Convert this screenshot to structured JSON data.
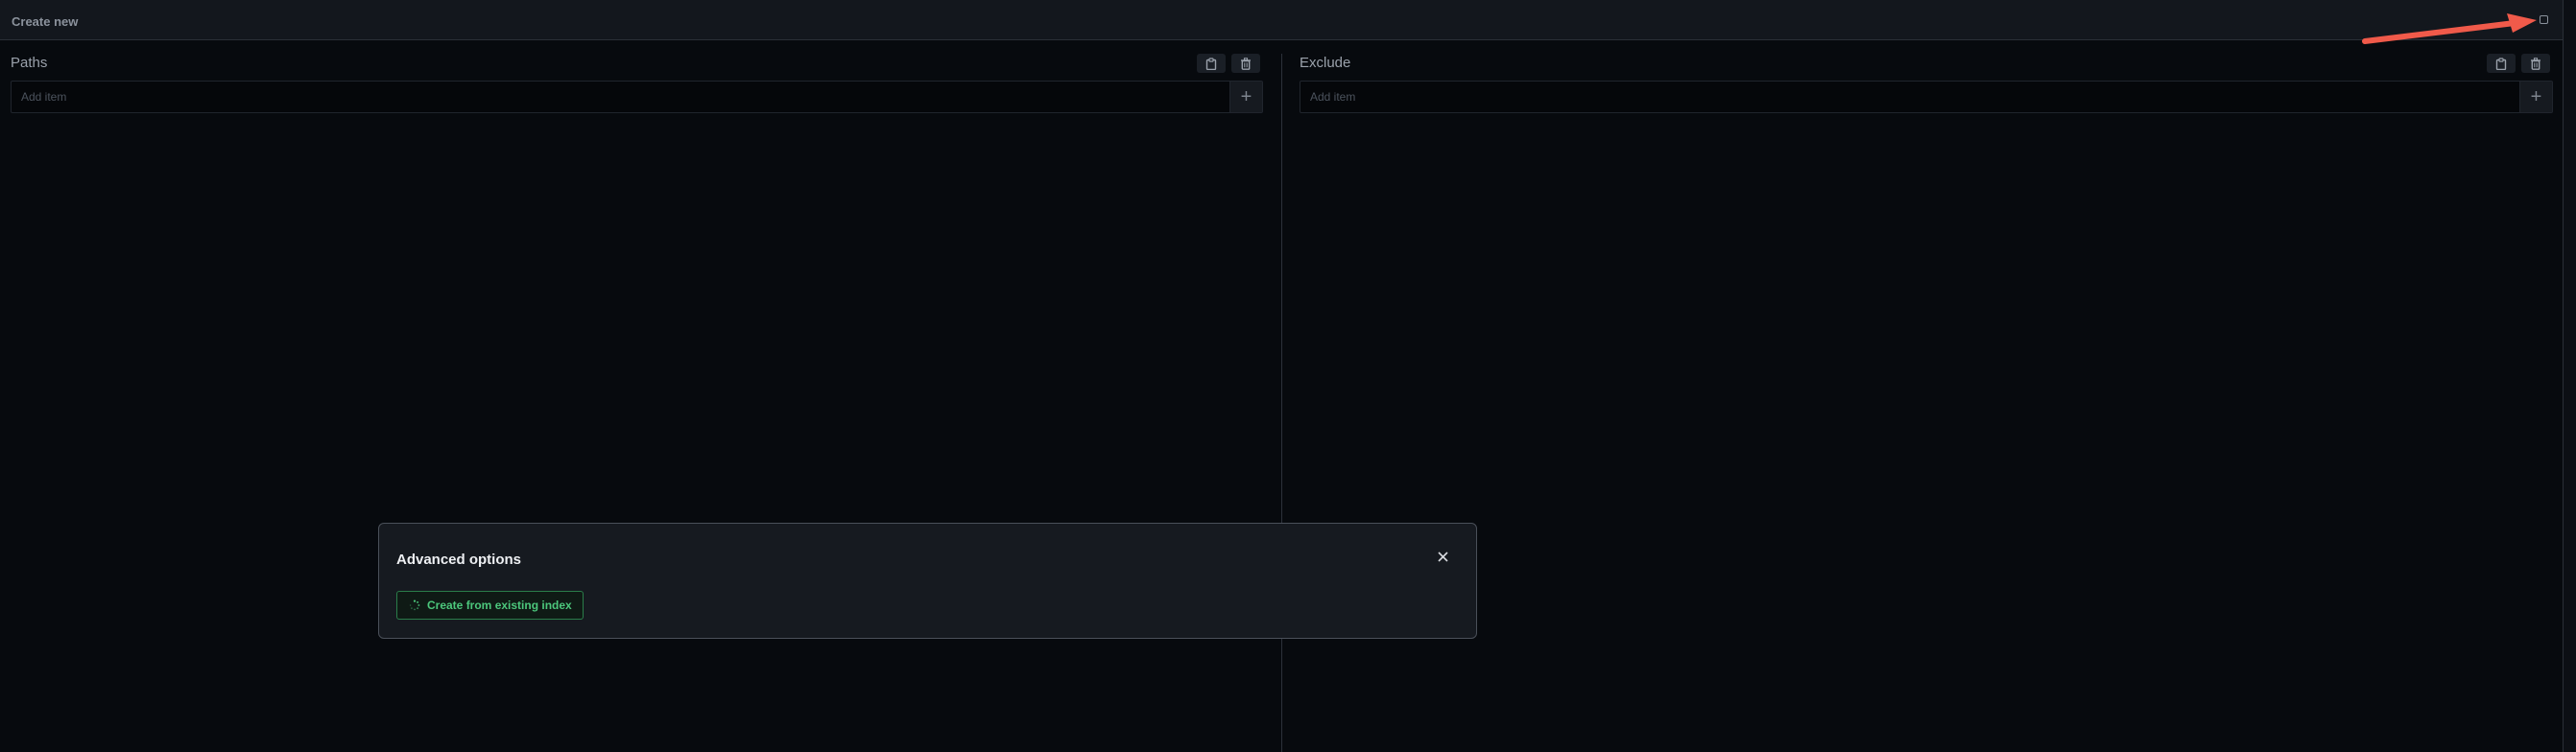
{
  "header": {
    "title": "Create new",
    "icon": "square-icon"
  },
  "panels": [
    {
      "label": "Paths",
      "input_placeholder": "Add item",
      "input_value": "",
      "add_button": "+",
      "icons": [
        "clipboard-icon",
        "trash-icon"
      ]
    },
    {
      "label": "Exclude",
      "input_placeholder": "Add item",
      "input_value": "",
      "add_button": "+",
      "icons": [
        "clipboard-icon",
        "trash-icon"
      ]
    }
  ],
  "modal": {
    "title": "Advanced options",
    "close_icon": "close-icon",
    "action_label": "Create from existing index",
    "action_icon": "spinner-icon"
  },
  "colors": {
    "background": "#070a0e",
    "header": "#13171d",
    "modal": "#161a20",
    "accent_green": "#4cc77c",
    "arrow": "#f05a4a"
  }
}
